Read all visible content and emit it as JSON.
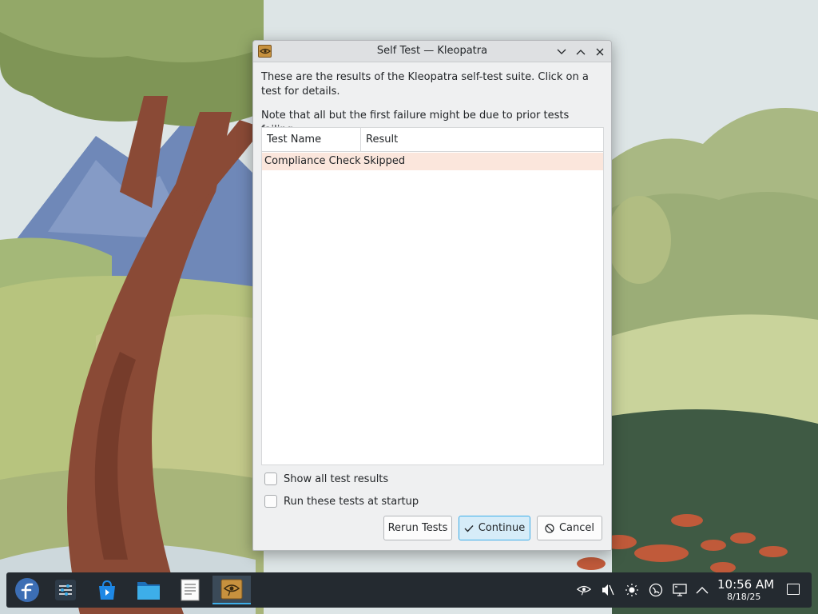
{
  "dialog": {
    "title": "Self Test — Kleopatra",
    "intro": "These are the results of the Kleopatra self-test suite. Click on a test for details.",
    "note": "Note that all but the first failure might be due to prior tests failing.",
    "columns": [
      "Test Name",
      "Result"
    ],
    "rows": [
      {
        "name": "Compliance Check",
        "result": "Skipped"
      }
    ],
    "show_all_label": "Show all test results",
    "run_startup_label": "Run these tests at startup",
    "rerun_label": "Rerun Tests",
    "continue_label": "Continue",
    "cancel_label": "Cancel",
    "row_highlight_color": "#fbe6dc",
    "accent_color": "#3daee9"
  },
  "taskbar": {
    "apps": [
      "fedora-launcher-icon",
      "system-settings-icon",
      "discover-icon",
      "dolphin-file-manager-icon",
      "text-editor-icon",
      "kleopatra-icon"
    ],
    "tray": [
      "kleopatra-tray-icon",
      "volume-muted-icon",
      "brightness-icon",
      "network-globe-icon",
      "wired-network-icon",
      "chevron-up-icon"
    ],
    "time": "10:56 AM",
    "date": "8/18/25"
  }
}
